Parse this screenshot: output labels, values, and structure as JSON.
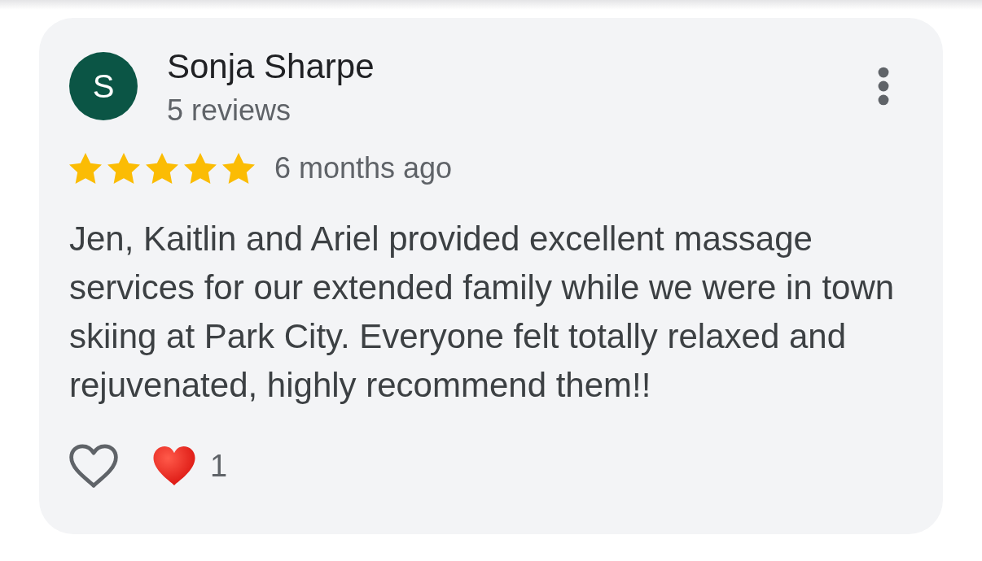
{
  "review": {
    "author": {
      "name": "Sonja Sharpe",
      "initial": "S",
      "reviews": "5 reviews"
    },
    "stars": 5,
    "time": "6 months ago",
    "text": "Jen, Kaitlin and Ariel provided excellent massage services for our extended family while we were in town skiing at Park City. Everyone felt totally relaxed and rejuvenated, highly recommend them!!",
    "liked": false,
    "reactions": [
      {
        "kind": "heart",
        "count": "1"
      }
    ]
  }
}
